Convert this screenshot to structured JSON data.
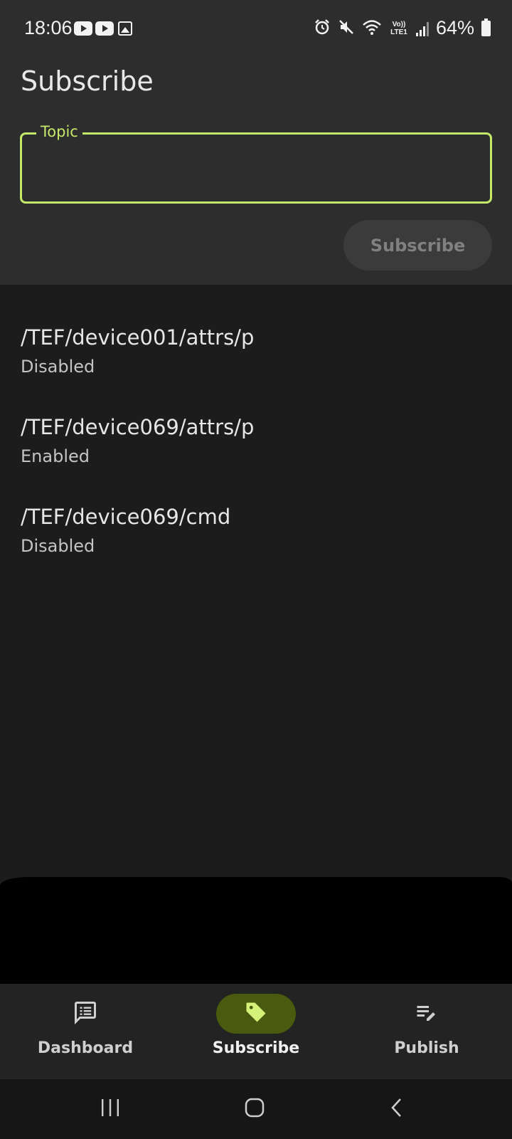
{
  "status_bar": {
    "time": "18:06",
    "battery": "64%",
    "lte_label": "Vo)) LTE1"
  },
  "header": {
    "title": "Subscribe"
  },
  "topic_field": {
    "label": "Topic",
    "value": "",
    "placeholder": ""
  },
  "subscribe_button": {
    "label": "Subscribe",
    "enabled": false
  },
  "subscriptions": [
    {
      "topic": "/TEF/device001/attrs/p",
      "status": "Disabled"
    },
    {
      "topic": "/TEF/device069/attrs/p",
      "status": "Enabled"
    },
    {
      "topic": "/TEF/device069/cmd",
      "status": "Disabled"
    }
  ],
  "bottom_nav": {
    "items": [
      {
        "label": "Dashboard",
        "icon": "dashboard-list-icon",
        "active": false
      },
      {
        "label": "Subscribe",
        "icon": "tag-icon",
        "active": true
      },
      {
        "label": "Publish",
        "icon": "edit-list-icon",
        "active": false
      }
    ]
  },
  "colors": {
    "accent": "#c6e868",
    "active_pill": "#4a5a0e",
    "background": "#1c1c1c",
    "top_panel": "#2d2d2d"
  }
}
